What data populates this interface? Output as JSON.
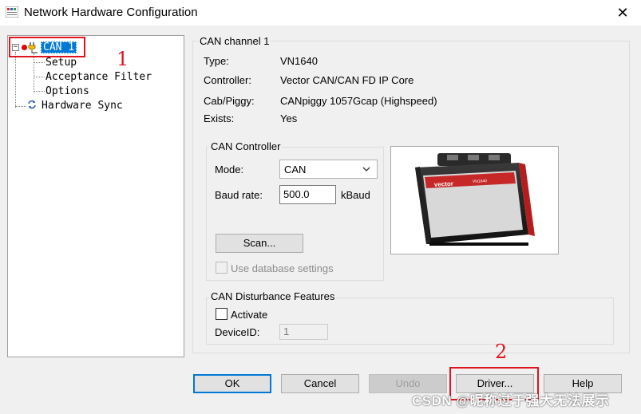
{
  "window": {
    "title": "Network Hardware Configuration",
    "close_glyph": "✕"
  },
  "tree": {
    "expander": "−",
    "can1": "CAN 1",
    "children": [
      "Setup",
      "Acceptance Filter",
      "Options"
    ],
    "hardware_sync": "Hardware Sync"
  },
  "annotations": {
    "one": "1",
    "two": "2",
    "color": "#e0141e"
  },
  "channel": {
    "group_label": "CAN channel 1",
    "props": [
      {
        "label": "Type:",
        "value": "VN1640"
      },
      {
        "label": "Controller:",
        "value": "Vector CAN/CAN FD IP Core"
      },
      {
        "label": "Cab/Piggy:",
        "value": "CANpiggy 1057Gcap (Highspeed)"
      },
      {
        "label": "Exists:",
        "value": "Yes"
      }
    ]
  },
  "controller": {
    "group_label": "CAN Controller",
    "mode_label": "Mode:",
    "mode_value": "CAN",
    "baud_label": "Baud rate:",
    "baud_value": "500.0",
    "baud_unit": "kBaud",
    "scan_button": "Scan...",
    "use_db_label": "Use database settings"
  },
  "disturbance": {
    "group_label": "CAN Disturbance Features",
    "activate_label": "Activate",
    "device_id_label": "DeviceID:",
    "device_id_value": "1"
  },
  "device_image": {
    "brand": "vector",
    "model": "VN1640"
  },
  "buttons": {
    "ok": "OK",
    "cancel": "Cancel",
    "undo": "Undo",
    "driver": "Driver...",
    "help": "Help"
  },
  "watermark": "CSDN @昵称过于强大无法展示",
  "colors": {
    "selection": "#0078d7",
    "default_button_border": "#0078d7"
  }
}
